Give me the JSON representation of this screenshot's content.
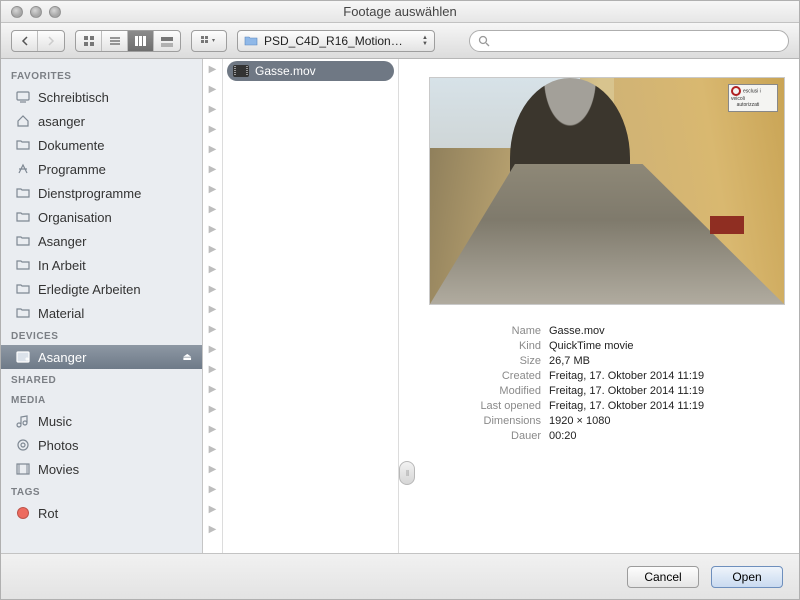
{
  "window": {
    "title": "Footage auswählen"
  },
  "toolbar": {
    "path_label": "PSD_C4D_R16_Motion…",
    "search_placeholder": ""
  },
  "sidebar": {
    "sections": [
      {
        "header": "FAVORITES",
        "items": [
          {
            "icon": "desktop",
            "label": "Schreibtisch"
          },
          {
            "icon": "home",
            "label": "asanger"
          },
          {
            "icon": "folder",
            "label": "Dokumente"
          },
          {
            "icon": "apps",
            "label": "Programme"
          },
          {
            "icon": "folder",
            "label": "Dienstprogramme"
          },
          {
            "icon": "folder",
            "label": "Organisation"
          },
          {
            "icon": "folder",
            "label": "Asanger"
          },
          {
            "icon": "folder",
            "label": "In Arbeit"
          },
          {
            "icon": "folder",
            "label": "Erledigte Arbeiten"
          },
          {
            "icon": "folder",
            "label": "Material"
          }
        ]
      },
      {
        "header": "DEVICES",
        "items": [
          {
            "icon": "drive",
            "label": "Asanger",
            "selected": true,
            "eject": true
          }
        ]
      },
      {
        "header": "SHARED",
        "items": []
      },
      {
        "header": "MEDIA",
        "items": [
          {
            "icon": "music",
            "label": "Music"
          },
          {
            "icon": "photos",
            "label": "Photos"
          },
          {
            "icon": "movies",
            "label": "Movies"
          }
        ]
      },
      {
        "header": "TAGS",
        "items": [
          {
            "icon": "tag",
            "label": "Rot",
            "color": "#ed6a5e"
          }
        ]
      }
    ]
  },
  "column": {
    "arrow_rows": 24,
    "files": [
      {
        "name": "Gasse.mov",
        "selected": true
      }
    ]
  },
  "preview": {
    "meta": [
      {
        "k": "Name",
        "v": "Gasse.mov"
      },
      {
        "k": "Kind",
        "v": "QuickTime movie"
      },
      {
        "k": "Size",
        "v": "26,7 MB"
      },
      {
        "k": "Created",
        "v": "Freitag, 17. Oktober 2014 11:19"
      },
      {
        "k": "Modified",
        "v": "Freitag, 17. Oktober 2014 11:19"
      },
      {
        "k": "Last opened",
        "v": "Freitag, 17. Oktober 2014 11:19"
      },
      {
        "k": "Dimensions",
        "v": "1920 × 1080"
      },
      {
        "k": "Dauer",
        "v": "00:20"
      }
    ],
    "sign_line1": "esclusi i veicoli",
    "sign_line2": "autorizzati"
  },
  "footer": {
    "cancel": "Cancel",
    "open": "Open"
  }
}
